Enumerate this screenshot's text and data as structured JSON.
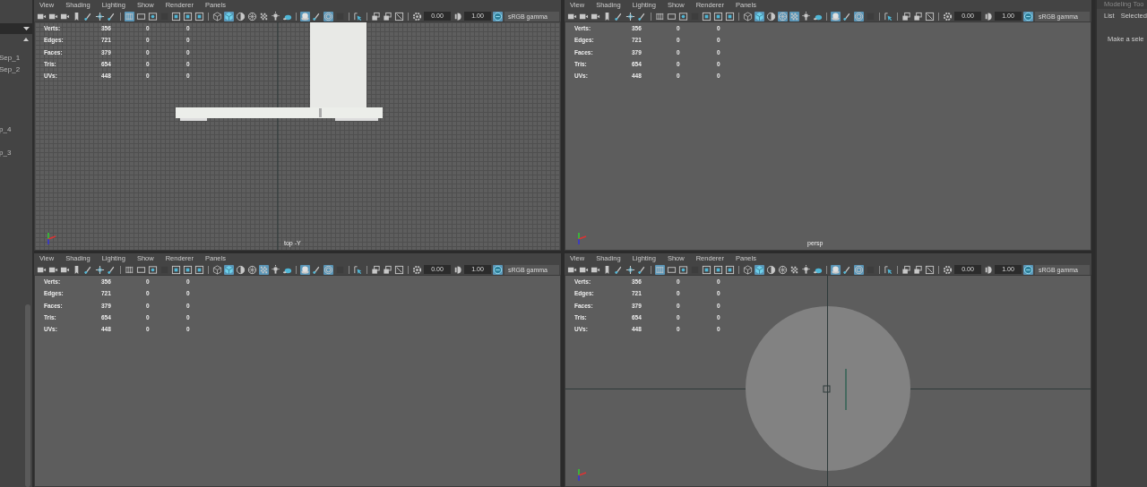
{
  "outliner": {
    "items": [
      "Sep_1",
      "Sep_2",
      "p_4",
      "p_3"
    ]
  },
  "viewports": [
    {
      "menu": [
        "View",
        "Shading",
        "Lighting",
        "Show",
        "Renderer",
        "Panels"
      ],
      "toolbar": [
        {
          "kind": "camera",
          "selected": false
        },
        {
          "kind": "camera",
          "selected": false
        },
        {
          "kind": "camera",
          "selected": false
        },
        {
          "kind": "bookmark",
          "selected": false
        },
        {
          "kind": "brush",
          "selected": false
        },
        {
          "kind": "move",
          "selected": false
        },
        {
          "kind": "brush",
          "selected": false
        },
        {
          "kind": "sep"
        },
        {
          "kind": "grid",
          "selected": true
        },
        {
          "kind": "frame",
          "selected": false
        },
        {
          "kind": "frame-dot",
          "selected": false
        },
        {
          "kind": "square",
          "selected": false
        },
        {
          "kind": "chart",
          "selected": false
        },
        {
          "kind": "chart",
          "selected": false
        },
        {
          "kind": "chart",
          "selected": false
        },
        {
          "kind": "sep"
        },
        {
          "kind": "cube",
          "selected": false
        },
        {
          "kind": "solid-cube",
          "selected": true
        },
        {
          "kind": "half-sphere",
          "selected": false
        },
        {
          "kind": "mesh-sphere",
          "selected": false
        },
        {
          "kind": "checker",
          "selected": false
        },
        {
          "kind": "bulb",
          "selected": false
        },
        {
          "kind": "shadow",
          "selected": false
        },
        {
          "kind": "sep"
        },
        {
          "kind": "sphere",
          "selected": true
        },
        {
          "kind": "brush",
          "selected": false
        },
        {
          "kind": "ring",
          "selected": true
        },
        {
          "kind": "square",
          "selected": false
        },
        {
          "kind": "sep"
        },
        {
          "kind": "arrow",
          "selected": false
        },
        {
          "kind": "sep"
        },
        {
          "kind": "windows",
          "selected": false
        },
        {
          "kind": "windows",
          "selected": false
        },
        {
          "kind": "resize",
          "selected": false
        },
        {
          "kind": "sep"
        },
        {
          "kind": "gear",
          "selected": false
        },
        {
          "kind": "field",
          "value": "0.00"
        },
        {
          "kind": "half-circle",
          "selected": false
        },
        {
          "kind": "field",
          "value": "1.00"
        },
        {
          "kind": "color",
          "selected": true
        },
        {
          "kind": "wide-field",
          "value": "sRGB gamma"
        }
      ],
      "stats": [
        {
          "label": "Verts:",
          "values": [
            "356",
            "0",
            "0"
          ]
        },
        {
          "label": "Edges:",
          "values": [
            "721",
            "0",
            "0"
          ]
        },
        {
          "label": "Faces:",
          "values": [
            "379",
            "0",
            "0"
          ]
        },
        {
          "label": "Tris:",
          "values": [
            "654",
            "0",
            "0"
          ]
        },
        {
          "label": "UVs:",
          "values": [
            "448",
            "0",
            "0"
          ]
        }
      ],
      "kind": "grid_model",
      "camera": "top -Y",
      "axis_indicator": true
    },
    {
      "menu": [
        "View",
        "Shading",
        "Lighting",
        "Show",
        "Renderer",
        "Panels"
      ],
      "toolbar": [
        {
          "kind": "camera",
          "selected": false
        },
        {
          "kind": "camera",
          "selected": false
        },
        {
          "kind": "camera",
          "selected": false
        },
        {
          "kind": "bookmark",
          "selected": false
        },
        {
          "kind": "brush",
          "selected": false
        },
        {
          "kind": "move",
          "selected": false
        },
        {
          "kind": "brush",
          "selected": false
        },
        {
          "kind": "sep"
        },
        {
          "kind": "grid",
          "selected": false
        },
        {
          "kind": "frame",
          "selected": false
        },
        {
          "kind": "frame-dot",
          "selected": false
        },
        {
          "kind": "square",
          "selected": false
        },
        {
          "kind": "chart",
          "selected": false
        },
        {
          "kind": "chart",
          "selected": false
        },
        {
          "kind": "chart",
          "selected": false
        },
        {
          "kind": "sep"
        },
        {
          "kind": "cube",
          "selected": false
        },
        {
          "kind": "solid-cube",
          "selected": true
        },
        {
          "kind": "half-sphere",
          "selected": false
        },
        {
          "kind": "mesh-sphere",
          "selected": true
        },
        {
          "kind": "checker",
          "selected": true
        },
        {
          "kind": "bulb",
          "selected": false
        },
        {
          "kind": "shadow",
          "selected": false
        },
        {
          "kind": "sep"
        },
        {
          "kind": "sphere",
          "selected": true
        },
        {
          "kind": "brush",
          "selected": false
        },
        {
          "kind": "ring",
          "selected": true
        },
        {
          "kind": "square",
          "selected": false
        },
        {
          "kind": "sep"
        },
        {
          "kind": "arrow",
          "selected": false
        },
        {
          "kind": "sep"
        },
        {
          "kind": "windows",
          "selected": false
        },
        {
          "kind": "windows",
          "selected": false
        },
        {
          "kind": "resize",
          "selected": false
        },
        {
          "kind": "sep"
        },
        {
          "kind": "gear",
          "selected": false
        },
        {
          "kind": "field",
          "value": "0.00"
        },
        {
          "kind": "half-circle",
          "selected": false
        },
        {
          "kind": "field",
          "value": "1.00"
        },
        {
          "kind": "color",
          "selected": true
        },
        {
          "kind": "wide-field",
          "value": "sRGB gamma"
        }
      ],
      "stats": [
        {
          "label": "Verts:",
          "values": [
            "356",
            "0",
            "0"
          ]
        },
        {
          "label": "Edges:",
          "values": [
            "721",
            "0",
            "0"
          ]
        },
        {
          "label": "Faces:",
          "values": [
            "379",
            "0",
            "0"
          ]
        },
        {
          "label": "Tris:",
          "values": [
            "654",
            "0",
            "0"
          ]
        },
        {
          "label": "UVs:",
          "values": [
            "448",
            "0",
            "0"
          ]
        }
      ],
      "kind": "plain",
      "camera": "persp",
      "axis_indicator": true
    },
    {
      "menu": [
        "View",
        "Shading",
        "Lighting",
        "Show",
        "Renderer",
        "Panels"
      ],
      "toolbar": [
        {
          "kind": "camera",
          "selected": false
        },
        {
          "kind": "camera",
          "selected": false
        },
        {
          "kind": "camera",
          "selected": false
        },
        {
          "kind": "bookmark",
          "selected": false
        },
        {
          "kind": "brush",
          "selected": false
        },
        {
          "kind": "move",
          "selected": false
        },
        {
          "kind": "brush",
          "selected": false
        },
        {
          "kind": "sep"
        },
        {
          "kind": "grid",
          "selected": false
        },
        {
          "kind": "frame",
          "selected": false
        },
        {
          "kind": "frame-dot",
          "selected": false
        },
        {
          "kind": "square",
          "selected": false
        },
        {
          "kind": "chart",
          "selected": false
        },
        {
          "kind": "chart",
          "selected": false
        },
        {
          "kind": "chart",
          "selected": false
        },
        {
          "kind": "sep"
        },
        {
          "kind": "cube",
          "selected": false
        },
        {
          "kind": "solid-cube",
          "selected": true
        },
        {
          "kind": "half-sphere",
          "selected": false
        },
        {
          "kind": "mesh-sphere",
          "selected": false
        },
        {
          "kind": "checker",
          "selected": true
        },
        {
          "kind": "bulb",
          "selected": false
        },
        {
          "kind": "shadow",
          "selected": false
        },
        {
          "kind": "sep"
        },
        {
          "kind": "sphere",
          "selected": true
        },
        {
          "kind": "brush",
          "selected": false
        },
        {
          "kind": "ring",
          "selected": true
        },
        {
          "kind": "square",
          "selected": false
        },
        {
          "kind": "sep"
        },
        {
          "kind": "arrow",
          "selected": false
        },
        {
          "kind": "sep"
        },
        {
          "kind": "windows",
          "selected": false
        },
        {
          "kind": "windows",
          "selected": false
        },
        {
          "kind": "resize",
          "selected": false
        },
        {
          "kind": "sep"
        },
        {
          "kind": "gear",
          "selected": false
        },
        {
          "kind": "field",
          "value": "0.00"
        },
        {
          "kind": "half-circle",
          "selected": false
        },
        {
          "kind": "field",
          "value": "1.00"
        },
        {
          "kind": "color",
          "selected": true
        },
        {
          "kind": "wide-field",
          "value": "sRGB gamma"
        }
      ],
      "stats": [
        {
          "label": "Verts:",
          "values": [
            "356",
            "0",
            "0"
          ]
        },
        {
          "label": "Edges:",
          "values": [
            "721",
            "0",
            "0"
          ]
        },
        {
          "label": "Faces:",
          "values": [
            "379",
            "0",
            "0"
          ]
        },
        {
          "label": "Tris:",
          "values": [
            "654",
            "0",
            "0"
          ]
        },
        {
          "label": "UVs:",
          "values": [
            "448",
            "0",
            "0"
          ]
        }
      ],
      "kind": "plain",
      "axis_indicator": false
    },
    {
      "menu": [
        "View",
        "Shading",
        "Lighting",
        "Show",
        "Renderer",
        "Panels"
      ],
      "toolbar": [
        {
          "kind": "camera",
          "selected": false
        },
        {
          "kind": "camera",
          "selected": false
        },
        {
          "kind": "camera",
          "selected": false
        },
        {
          "kind": "bookmark",
          "selected": false
        },
        {
          "kind": "brush",
          "selected": false
        },
        {
          "kind": "move",
          "selected": false
        },
        {
          "kind": "brush",
          "selected": false
        },
        {
          "kind": "sep"
        },
        {
          "kind": "grid",
          "selected": true
        },
        {
          "kind": "frame",
          "selected": false
        },
        {
          "kind": "frame-dot",
          "selected": false
        },
        {
          "kind": "square",
          "selected": false
        },
        {
          "kind": "chart",
          "selected": false
        },
        {
          "kind": "chart",
          "selected": false
        },
        {
          "kind": "chart",
          "selected": false
        },
        {
          "kind": "sep"
        },
        {
          "kind": "cube",
          "selected": false
        },
        {
          "kind": "solid-cube",
          "selected": true
        },
        {
          "kind": "half-sphere",
          "selected": false
        },
        {
          "kind": "mesh-sphere",
          "selected": false
        },
        {
          "kind": "checker",
          "selected": false
        },
        {
          "kind": "bulb",
          "selected": false
        },
        {
          "kind": "shadow",
          "selected": false
        },
        {
          "kind": "sep"
        },
        {
          "kind": "sphere",
          "selected": true
        },
        {
          "kind": "brush",
          "selected": false
        },
        {
          "kind": "ring",
          "selected": true
        },
        {
          "kind": "square",
          "selected": false
        },
        {
          "kind": "sep"
        },
        {
          "kind": "arrow",
          "selected": false
        },
        {
          "kind": "sep"
        },
        {
          "kind": "windows",
          "selected": false
        },
        {
          "kind": "windows",
          "selected": false
        },
        {
          "kind": "resize",
          "selected": false
        },
        {
          "kind": "sep"
        },
        {
          "kind": "gear",
          "selected": false
        },
        {
          "kind": "field",
          "value": "0.00"
        },
        {
          "kind": "half-circle",
          "selected": false
        },
        {
          "kind": "field",
          "value": "1.00"
        },
        {
          "kind": "color",
          "selected": true
        },
        {
          "kind": "wide-field",
          "value": "sRGB gamma"
        }
      ],
      "stats": [
        {
          "label": "Verts:",
          "values": [
            "356",
            "0",
            "0"
          ]
        },
        {
          "label": "Edges:",
          "values": [
            "721",
            "0",
            "0"
          ]
        },
        {
          "label": "Faces:",
          "values": [
            "379",
            "0",
            "0"
          ]
        },
        {
          "label": "Tris:",
          "values": [
            "654",
            "0",
            "0"
          ]
        },
        {
          "label": "UVs:",
          "values": [
            "448",
            "0",
            "0"
          ]
        }
      ],
      "kind": "circle",
      "axis_indicator": true
    }
  ],
  "tool_panel": {
    "title": "Modeling Too",
    "tabs": [
      "List",
      "Selected"
    ],
    "message": "Make a sele"
  }
}
